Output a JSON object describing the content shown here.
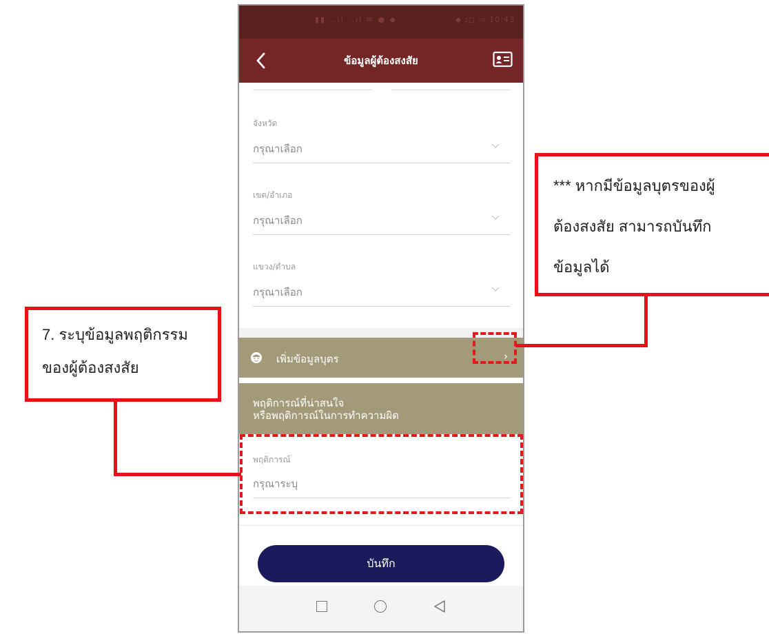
{
  "status_bar": {
    "left_icons": "▮▮ ..ıl ..ıl ✉ ● ◆",
    "right_text": "◆ ɪ◻ ▭ 10:43"
  },
  "app_bar": {
    "title": "ข้อมูลผู้ต้องสงสัย"
  },
  "form": {
    "province": {
      "label": "จังหวัด",
      "value": "กรุณาเลือก"
    },
    "district": {
      "label": "เขต/อำเภอ",
      "value": "กรุณาเลือก"
    },
    "subdistrict": {
      "label": "แขวง/ตำบล",
      "value": "กรุณาเลือก"
    }
  },
  "child_row": {
    "label": "เพิ่มข้อมูลบุตร",
    "arrow": "›"
  },
  "behavior_section": {
    "header_line1": "พฤติการณ์ที่น่าสนใจ",
    "header_line2": "หรือพฤติการณ์ในการทำความผิด",
    "field_label": "พฤติการณ์",
    "field_placeholder": "กรุณาระบุ"
  },
  "save_button": {
    "label": "บันทึก"
  },
  "annotations": {
    "left_callout": [
      "7. ระบุข้อมูลพฤติกรรม",
      "ของผู้ต้องสงสัย"
    ],
    "right_callout": [
      "*** หากมีข้อมูลบุตรของผู้",
      "ต้องสงสัย สามารถบันทึก",
      "ข้อมูลได้"
    ]
  },
  "colors": {
    "status_bar": "#58201e",
    "app_bar": "#742526",
    "section_header": "#a29a78",
    "save_button": "#1b1a5c",
    "annotation_red": "#e8111a"
  }
}
